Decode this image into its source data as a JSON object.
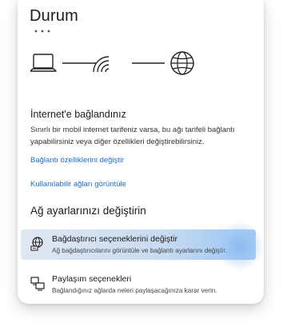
{
  "header": {
    "title": "Durum"
  },
  "network_diagram": {
    "icons": [
      "laptop-icon",
      "wifi-icon",
      "globe-icon"
    ]
  },
  "status": {
    "heading": "İnternet'e bağlandınız",
    "description": "Sınırlı bir mobil internet tarifeniz varsa, bu ağı tarifeli bağlantı yapabilirsiniz veya diğer özellikleri değiştirebilirsiniz."
  },
  "links": {
    "connection_properties": "Bağlantı özelliklerini değiştir",
    "available_networks": "Kullanılabilir ağları görüntüle"
  },
  "advanced": {
    "heading": "Ağ ayarlarınızı değiştirin",
    "options": [
      {
        "icon": "network-adapter-icon",
        "title": "Bağdaştırıcı seçeneklerini değiştir",
        "subtitle": "Ağ bağdaştırıcılarını görüntüle ve bağlantı ayarlarını değiştir."
      },
      {
        "icon": "sharing-icon",
        "title": "Paylaşım seçenekleri",
        "subtitle": "Bağlandığınız ağlarda neleri paylaşacağınıza karar verin."
      }
    ]
  },
  "colors": {
    "link": "#1a6fc4",
    "highlight": "#c9dbf1",
    "text": "#1b1b1b"
  }
}
